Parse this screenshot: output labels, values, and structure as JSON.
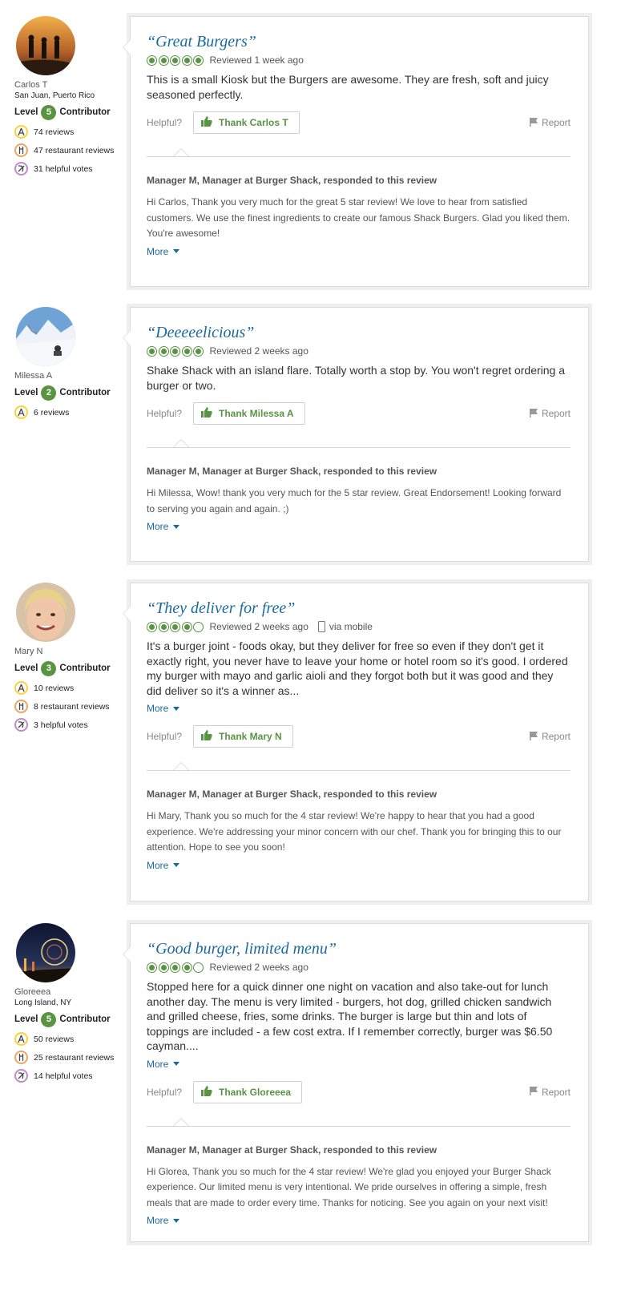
{
  "ui": {
    "helpful_label": "Helpful?",
    "report_label": "Report",
    "more_label": "More",
    "mobile_label": "via mobile",
    "level_label": "Level",
    "contributor_label": "Contributor"
  },
  "colors": {
    "bubble_green": "#589442",
    "title_blue": "#1a6aa0",
    "badge_green": "#589442"
  },
  "reviews": [
    {
      "reviewer": {
        "name": "Carlos T",
        "location": "San Juan, Puerto Rico",
        "level": "5",
        "stats": [
          "74 reviews",
          "47 restaurant reviews",
          "31 helpful votes"
        ]
      },
      "title": "“Great Burgers”",
      "rating": 5,
      "date": "Reviewed 1 week ago",
      "via_mobile": false,
      "body": "This is a small Kiosk but the Burgers are awesome. They are fresh, soft and juicy seasoned perfectly.",
      "has_more_in_body": false,
      "thank_label": "Thank Carlos T",
      "response_header": "Manager M, Manager at Burger Shack, responded to this review",
      "response_body": "Hi Carlos, Thank you very much for the great 5 star review! We love to hear from satisfied customers. We use the finest ingredients to create our famous Shack Burgers. Glad you liked them. You're awesome!"
    },
    {
      "reviewer": {
        "name": "Milessa A",
        "location": "",
        "level": "2",
        "stats": [
          "6 reviews"
        ]
      },
      "title": "“Deeeeelicious”",
      "rating": 5,
      "date": "Reviewed 2 weeks ago",
      "via_mobile": false,
      "body": "Shake Shack with an island flare. Totally worth a stop by. You won't regret ordering a burger or two.",
      "has_more_in_body": false,
      "thank_label": "Thank Milessa A",
      "response_header": "Manager M, Manager at Burger Shack, responded to this review",
      "response_body": "Hi Milessa, Wow! thank you very much for the 5 star review. Great Endorsement! Looking forward to serving you again and again. ;)"
    },
    {
      "reviewer": {
        "name": "Mary N",
        "location": "",
        "level": "3",
        "stats": [
          "10 reviews",
          "8 restaurant reviews",
          "3 helpful votes"
        ]
      },
      "title": "“They deliver for free”",
      "rating": 4,
      "date": "Reviewed 2 weeks ago",
      "via_mobile": true,
      "body": "It's a burger joint - foods okay, but they deliver for free so even if they don't get it exactly right, you never have to leave your home or hotel room so it's good. I ordered my burger with mayo and garlic aioli and they forgot both but it was good and they did deliver so it's a winner as...",
      "has_more_in_body": true,
      "thank_label": "Thank Mary N",
      "response_header": "Manager M, Manager at Burger Shack, responded to this review",
      "response_body": "Hi Mary, Thank you so much for the 4 star review! We're happy to hear that you had a good experience. We're addressing your minor concern with our chef. Thank you for bringing this to our attention. Hope to see you soon!"
    },
    {
      "reviewer": {
        "name": "Gloreeea",
        "location": "Long Island, NY",
        "level": "5",
        "stats": [
          "50 reviews",
          "25 restaurant reviews",
          "14 helpful votes"
        ]
      },
      "title": "“Good burger, limited menu”",
      "rating": 4,
      "date": "Reviewed 2 weeks ago",
      "via_mobile": false,
      "body": "Stopped here for a quick dinner one night on vacation and also take-out for lunch another day. The menu is very limited - burgers, hot dog, grilled chicken sandwich and grilled cheese, fries, some drinks. The burger is large but thin and lots of toppings are included - a few cost extra. If I remember correctly, burger was $6.50 cayman....",
      "has_more_in_body": true,
      "thank_label": "Thank Gloreeea",
      "response_header": "Manager M, Manager at Burger Shack, responded to this review",
      "response_body": "Hi Glorea, Thank you so much for the 4 star review! We're glad you enjoyed your Burger Shack experience. Our limited menu is very intentional. We pride ourselves in offering a simple, fresh meals that are made to order every time. Thanks for noticing. See you again on your next visit!"
    }
  ]
}
